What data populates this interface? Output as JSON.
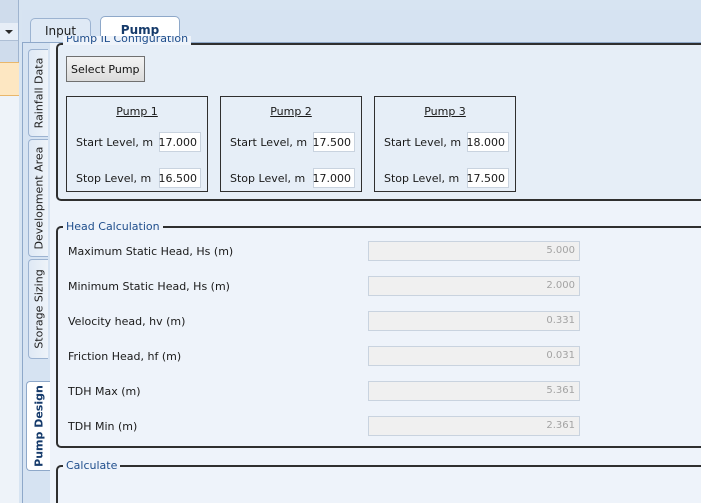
{
  "tabs": [
    {
      "label": "Input",
      "active": false
    },
    {
      "label": "Pump",
      "active": true
    }
  ],
  "side_tabs": [
    {
      "label": "Rainfall Data",
      "active": false
    },
    {
      "label": "Development Area",
      "active": false
    },
    {
      "label": "Storage Sizing",
      "active": false
    },
    {
      "label": "Pump Design",
      "active": true
    }
  ],
  "pump_config": {
    "legend": "Pump IL Configuration",
    "select_button": "Select Pump",
    "pumps": [
      {
        "title": "Pump 1",
        "start_label": "Start Level, m",
        "start_value": "17.000",
        "stop_label": "Stop Level, m",
        "stop_value": "16.500"
      },
      {
        "title": "Pump 2",
        "start_label": "Start Level, m",
        "start_value": "17.500",
        "stop_label": "Stop Level, m",
        "stop_value": "17.000"
      },
      {
        "title": "Pump 3",
        "start_label": "Start Level, m",
        "start_value": "18.000",
        "stop_label": "Stop Level, m",
        "stop_value": "17.500"
      }
    ]
  },
  "head_calc": {
    "legend": "Head Calculation",
    "rows": [
      {
        "label": "Maximum Static Head, Hs (m)",
        "value": "5.000"
      },
      {
        "label": "Minimum Static Head, Hs (m)",
        "value": "2.000"
      },
      {
        "label": "Velocity head, hv (m)",
        "value": "0.331"
      },
      {
        "label": "Friction Head, hf (m)",
        "value": "0.031"
      },
      {
        "label": "TDH Max (m)",
        "value": "5.361"
      },
      {
        "label": "TDH Min (m)",
        "value": "2.361"
      }
    ]
  },
  "calculate": {
    "legend": "Calculate"
  },
  "colors": {
    "accent": "#1f4e8c",
    "panel_bg": "#eef3fa",
    "tab_bg": "#d6e3f2"
  }
}
